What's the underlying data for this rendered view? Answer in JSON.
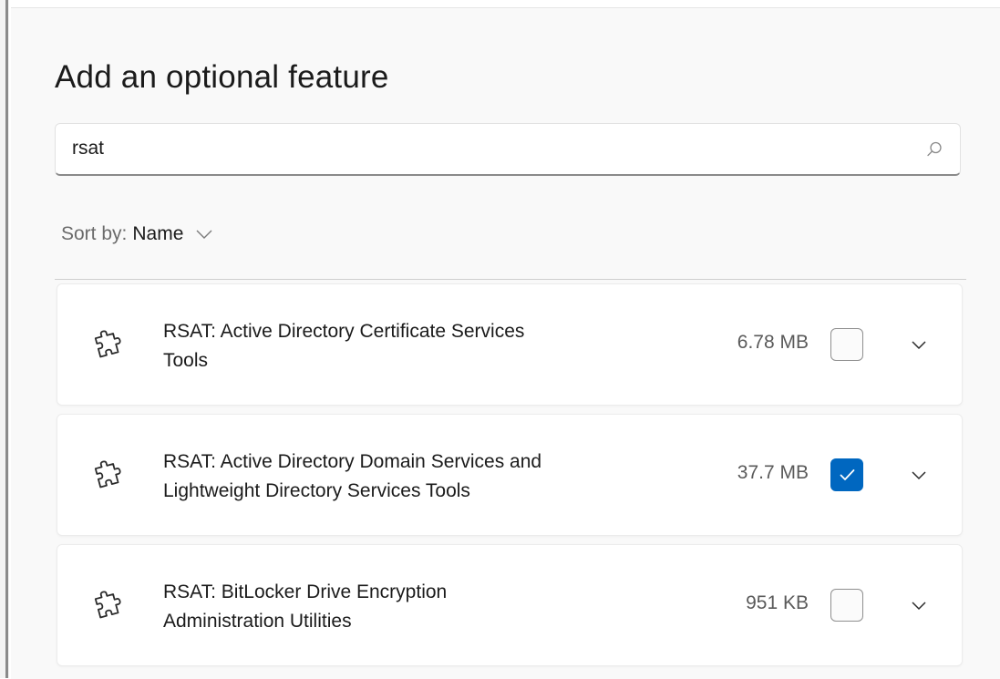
{
  "dialog": {
    "title": "Add an optional feature"
  },
  "search": {
    "value": "rsat",
    "icon": "search-icon"
  },
  "sort": {
    "label": "Sort by:",
    "value": "Name",
    "icon": "chevron-down-icon"
  },
  "features": [
    {
      "line1": "RSAT: Active Directory Certificate Services",
      "line2": "Tools",
      "size": "6.78 MB",
      "checked": false
    },
    {
      "line1": "RSAT: Active Directory Domain Services and",
      "line2": "Lightweight Directory Services Tools",
      "size": "37.7 MB",
      "checked": true
    },
    {
      "line1": "RSAT: BitLocker Drive Encryption",
      "line2": "Administration Utilities",
      "size": "951 KB",
      "checked": false
    }
  ],
  "colors": {
    "accent": "#0067c0",
    "background": "#f9f9f9",
    "card": "#ffffff"
  }
}
